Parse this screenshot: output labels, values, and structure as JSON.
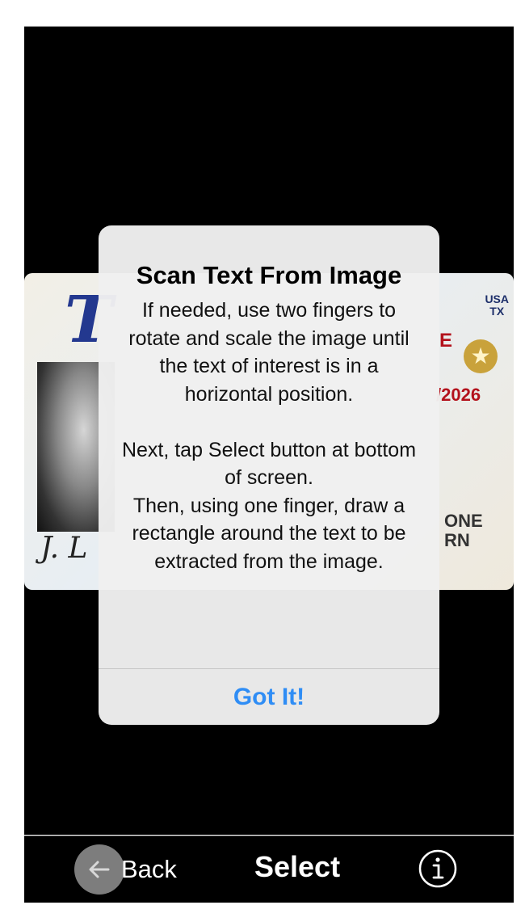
{
  "card": {
    "letter": "T",
    "usa": "USA",
    "state": "TX",
    "star": "★",
    "e": "E",
    "date": "/2026",
    "one_line1": "ONE",
    "one_line2": "RN",
    "sign": "J. L"
  },
  "dialog": {
    "title": "Scan Text From Image",
    "body": "If needed, use two fingers to rotate and scale the image until the text of interest is in a horizontal position.\n\nNext, tap Select button at bottom of screen.\nThen, using one finger, draw a rectangle around the text to be extracted from the image.",
    "button": "Got It!"
  },
  "bottom_bar": {
    "back_label": "Back",
    "back_icon": "left-arrow-icon",
    "select_label": "Select",
    "info_icon": "info-icon"
  }
}
